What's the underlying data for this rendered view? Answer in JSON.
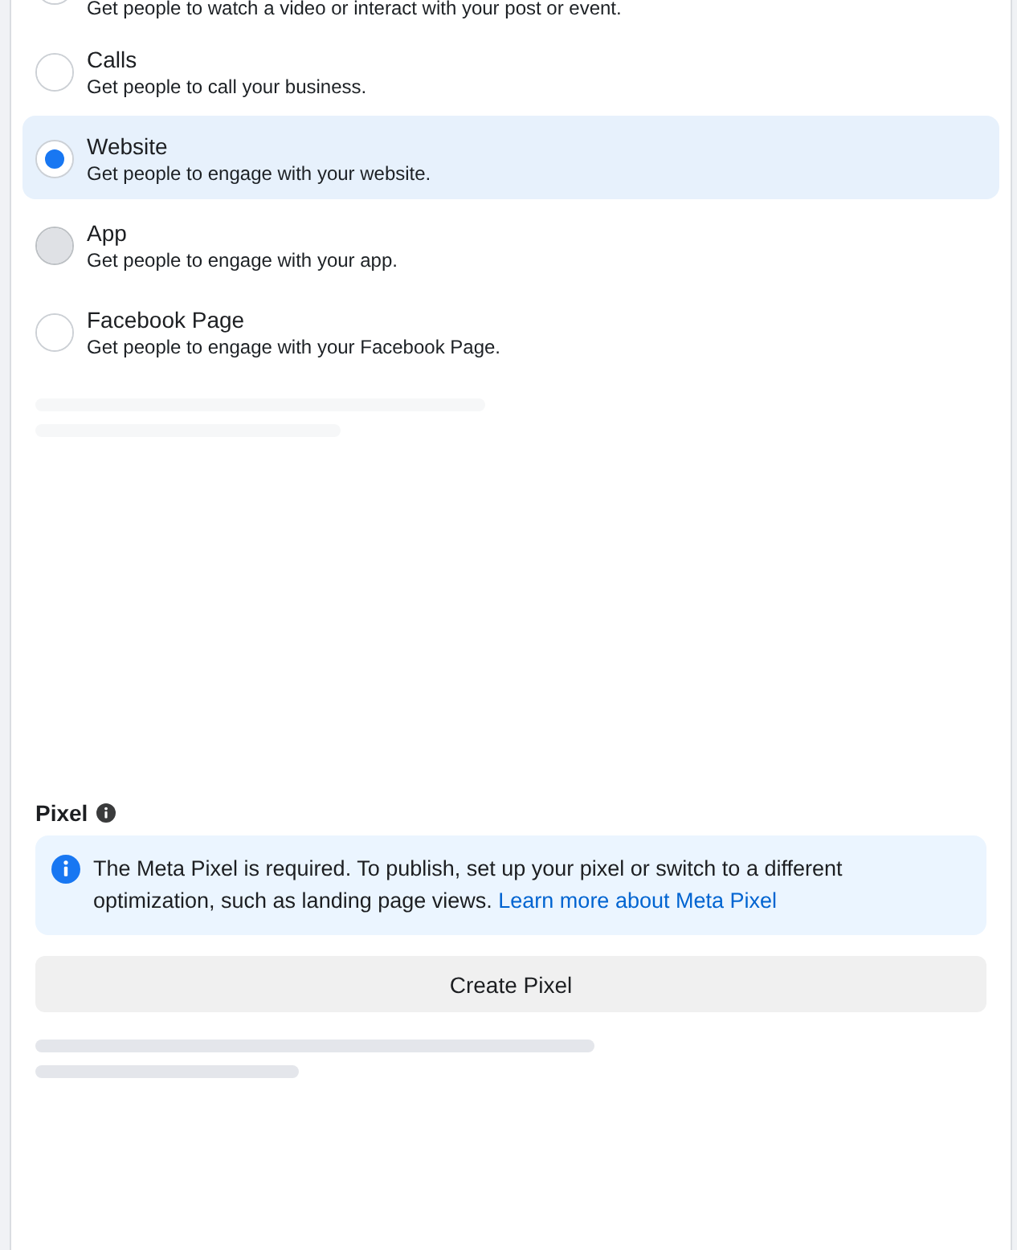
{
  "options": [
    {
      "description": "Get people to watch a video or interact with your post or event.",
      "selected": false,
      "hovered": false
    },
    {
      "label": "Calls",
      "description": "Get people to call your business.",
      "selected": false,
      "hovered": false
    },
    {
      "label": "Website",
      "description": "Get people to engage with your website.",
      "selected": true,
      "hovered": false
    },
    {
      "label": "App",
      "description": "Get people to engage with your app.",
      "selected": false,
      "hovered": true
    },
    {
      "label": "Facebook Page",
      "description": "Get people to engage with your Facebook Page.",
      "selected": false,
      "hovered": false
    }
  ],
  "pixel": {
    "label": "Pixel",
    "notice": {
      "text": "The Meta Pixel is required. To publish, set up your pixel or switch to a different optimization, such as landing page views.",
      "link": "Learn more about Meta Pixel"
    },
    "button": "Create Pixel"
  }
}
